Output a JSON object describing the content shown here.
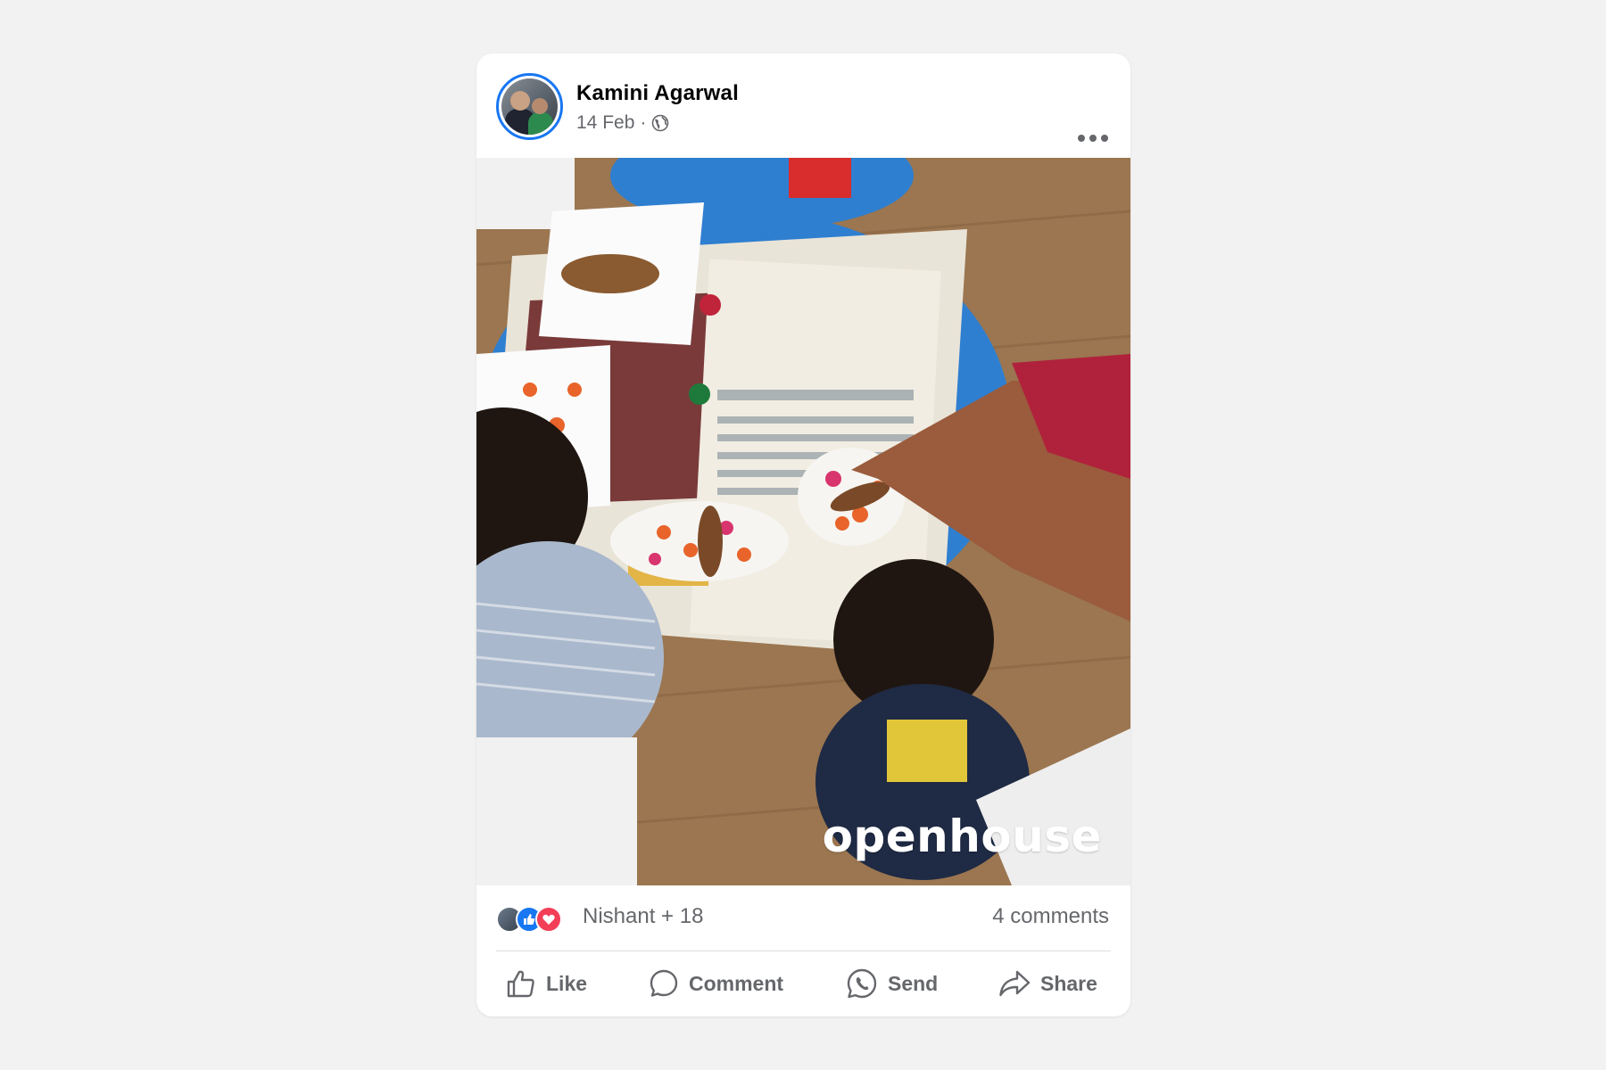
{
  "post": {
    "author": "Kamini Agarwal",
    "date": "14 Feb",
    "separator": "·",
    "privacy_icon": "globe-icon",
    "more_icon": "more-horizontal-icon"
  },
  "photo": {
    "watermark": "openhouse"
  },
  "reactions": {
    "icons": [
      "avatar",
      "like-reaction-icon",
      "love-reaction-icon"
    ],
    "summary": "Nishant + 18",
    "comments": "4 comments"
  },
  "actions": {
    "like": "Like",
    "comment": "Comment",
    "send": "Send",
    "share": "Share"
  },
  "colors": {
    "accent": "#1877f2",
    "love": "#f33e58",
    "secondary_text": "#65676b",
    "background": "#f2f2f2"
  }
}
